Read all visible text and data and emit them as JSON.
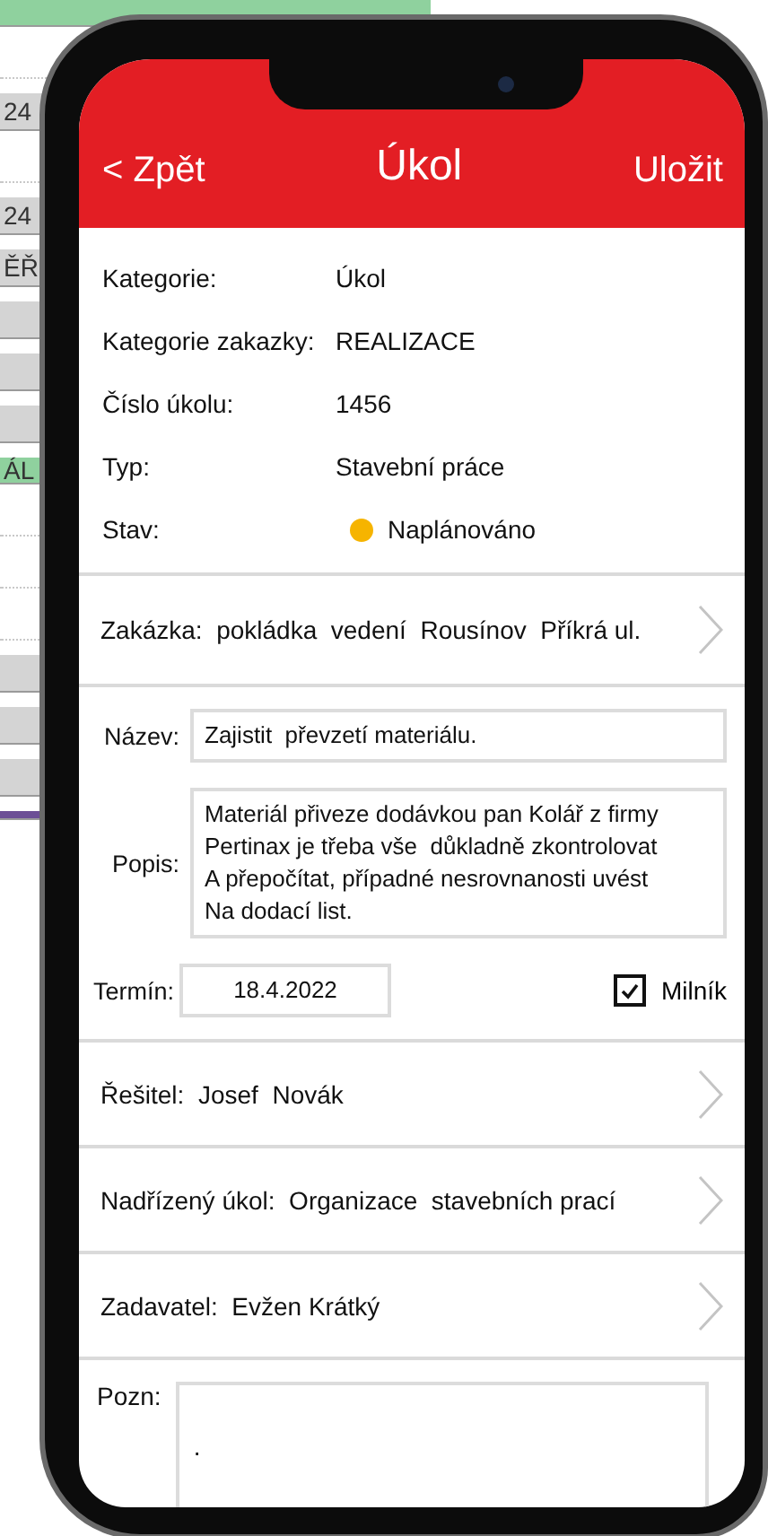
{
  "background_sheet": {
    "cells": [
      {
        "kind": "green",
        "text": ""
      },
      {
        "kind": "blank",
        "text": ""
      },
      {
        "kind": "gray",
        "text": "24"
      },
      {
        "kind": "blank",
        "text": ""
      },
      {
        "kind": "gray",
        "text": "24"
      },
      {
        "kind": "gray",
        "text": "ĚŘ"
      },
      {
        "kind": "gray",
        "text": ""
      },
      {
        "kind": "gray",
        "text": ""
      },
      {
        "kind": "gray",
        "text": ""
      },
      {
        "kind": "green",
        "text": "ÁL"
      },
      {
        "kind": "blank",
        "text": ""
      },
      {
        "kind": "blank",
        "text": ""
      },
      {
        "kind": "blank",
        "text": ""
      },
      {
        "kind": "gray",
        "text": ""
      },
      {
        "kind": "gray",
        "text": ""
      },
      {
        "kind": "gray",
        "text": ""
      },
      {
        "kind": "purple",
        "text": ""
      }
    ]
  },
  "header": {
    "back": "< Zpět",
    "title": "Úkol",
    "save": "Uložit"
  },
  "details": [
    {
      "label": "Kategorie:",
      "value": "Úkol"
    },
    {
      "label": "Kategorie zakazky:",
      "value": "REALIZACE"
    },
    {
      "label": "Číslo úkolu:",
      "value": "1456"
    },
    {
      "label": "Typ:",
      "value": "Stavební práce"
    }
  ],
  "status": {
    "label": "Stav:",
    "value": "Naplánováno",
    "color": "#f6b400"
  },
  "order": {
    "text": "Zakázka:  pokládka  vedení  Rousínov  Příkrá ul."
  },
  "name_field": {
    "label": "Název:",
    "value": "Zajistit  převzetí materiálu."
  },
  "description": {
    "label": "Popis:",
    "value": "Materiál přiveze dodávkou pan Kolář z firmy\nPertinax je třeba vše  důkladně zkontrolovat\nA přepočítat, případné nesrovnanosti uvést\nNa dodací list."
  },
  "deadline": {
    "label": "Termín:",
    "value": "18.4.2022"
  },
  "milestone": {
    "label": "Milník",
    "checked": true
  },
  "links": [
    {
      "text": "Řešitel:  Josef  Novák"
    },
    {
      "text": "Nadřízený úkol:  Organizace  stavebních prací"
    },
    {
      "text": "Zadavatel:  Evžen Krátký"
    }
  ],
  "note": {
    "label": "Pozn:",
    "value": "."
  }
}
